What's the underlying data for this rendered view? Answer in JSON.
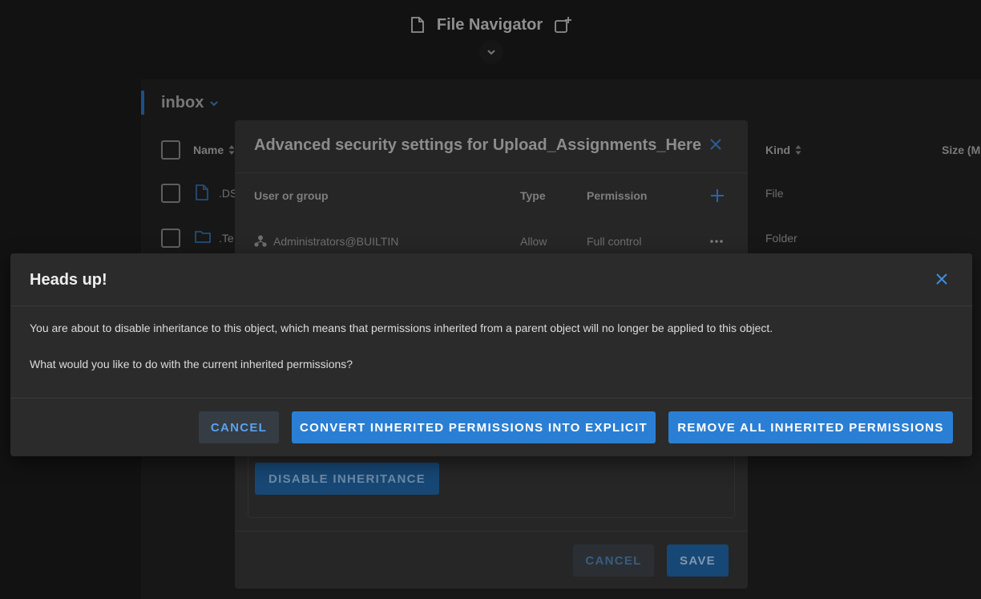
{
  "app": {
    "title": "File Navigator"
  },
  "explorer": {
    "folder": "inbox",
    "columns": {
      "name": "Name",
      "kind": "Kind",
      "size": "Size (M"
    },
    "rows": [
      {
        "name": ".DS",
        "kind": "File"
      },
      {
        "name": ".Te",
        "kind": "Folder"
      }
    ]
  },
  "security_dialog": {
    "title": "Advanced security settings for Upload_Assignments_Here",
    "columns": {
      "user": "User or group",
      "type": "Type",
      "permission": "Permission"
    },
    "entries": [
      {
        "user": "Administrators@BUILTIN",
        "type": "Allow",
        "permission": "Full control"
      }
    ],
    "disable_inheritance_label": "DISABLE INHERITANCE",
    "cancel_label": "CANCEL",
    "save_label": "SAVE"
  },
  "alert": {
    "title": "Heads up!",
    "message": "You are about to disable inheritance to this object, which means that permissions inherited from a parent object will no longer be applied to this object.",
    "question": "What would you like to do with the current inherited permissions?",
    "cancel_label": "CANCEL",
    "convert_label": "CONVERT INHERITED PERMISSIONS INTO EXPLICIT",
    "remove_label": "REMOVE ALL INHERITED PERMISSIONS"
  },
  "icons": {
    "app": "document-icon",
    "new_window": "new-window-icon",
    "collapse": "chevron-down-icon",
    "file": "file-icon",
    "folder": "folder-icon",
    "group": "group-icon",
    "add": "plus-icon",
    "more": "more-horizontal-icon",
    "close": "close-icon"
  },
  "colors": {
    "accent": "#2a7fd4",
    "background": "#121212",
    "dialog": "#2b2b2b"
  }
}
